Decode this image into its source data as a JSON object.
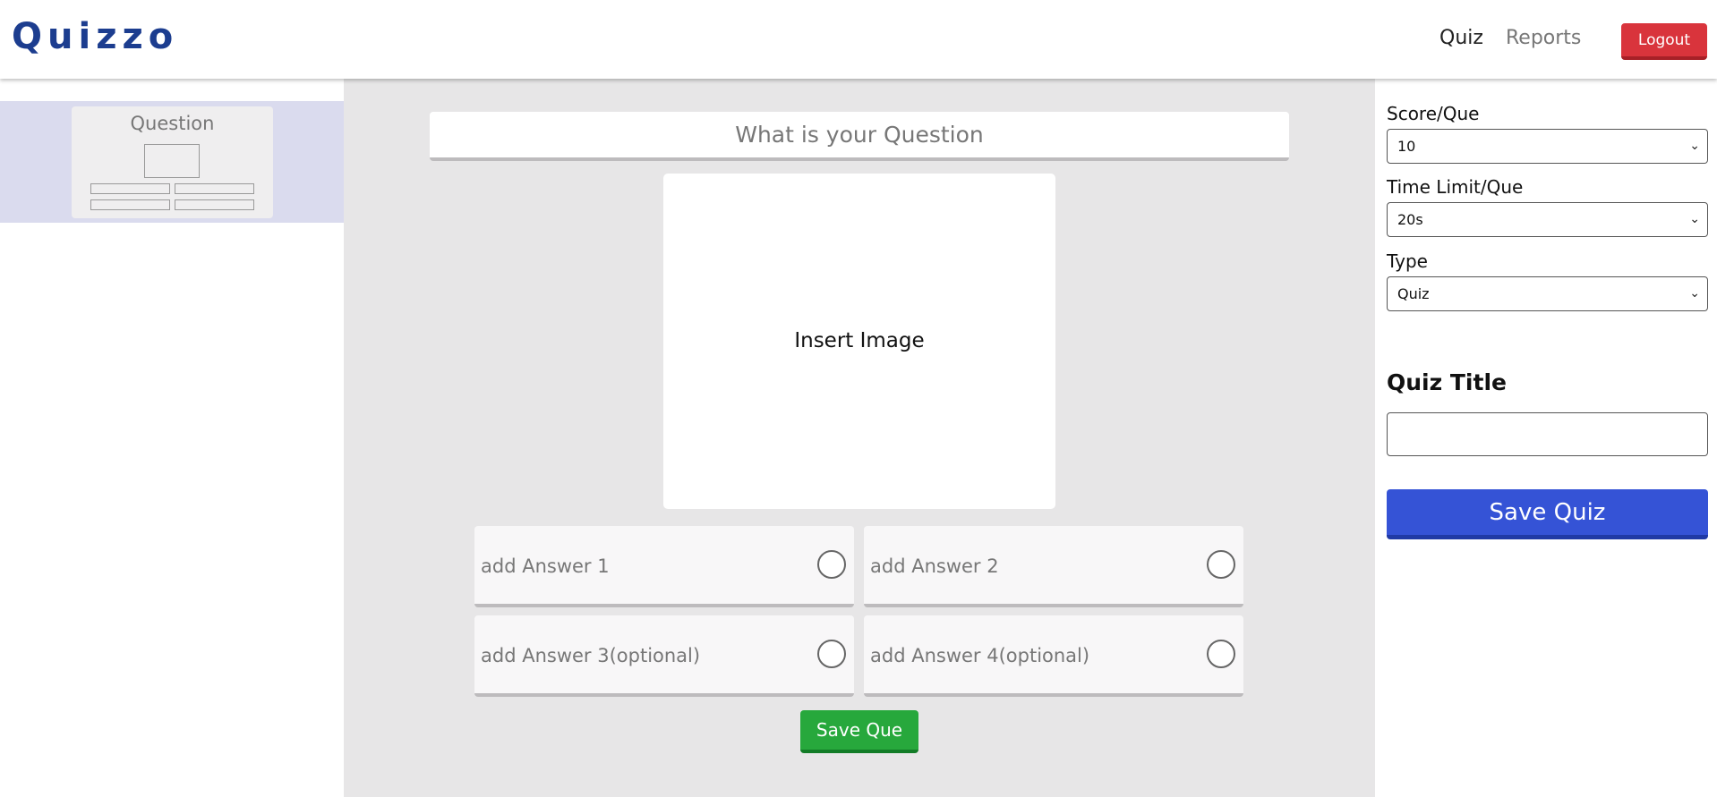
{
  "header": {
    "logo": "Quizzo",
    "nav": {
      "quiz": "Quiz",
      "reports": "Reports"
    },
    "logout_label": "Logout"
  },
  "sidebar": {
    "slides": [
      {
        "label": "Question"
      }
    ]
  },
  "editor": {
    "question_placeholder": "What is your Question",
    "image_label": "Insert Image",
    "answers": [
      {
        "placeholder": "add Answer 1"
      },
      {
        "placeholder": "add Answer 2"
      },
      {
        "placeholder": "add Answer 3(optional)"
      },
      {
        "placeholder": "add Answer 4(optional)"
      }
    ],
    "save_que_label": "Save Que"
  },
  "settings": {
    "score": {
      "label": "Score/Que",
      "value": "10"
    },
    "time_limit": {
      "label": "Time Limit/Que",
      "value": "20s"
    },
    "type": {
      "label": "Type",
      "value": "Quiz"
    },
    "quiz_title_label": "Quiz Title",
    "quiz_title_value": "",
    "save_quiz_label": "Save Quiz"
  },
  "colors": {
    "brand": "#1c3d8f",
    "logout": "#d9343c",
    "save_que": "#27a83c",
    "save_quiz": "#3553d6",
    "selected_slide": "#dadbee"
  }
}
